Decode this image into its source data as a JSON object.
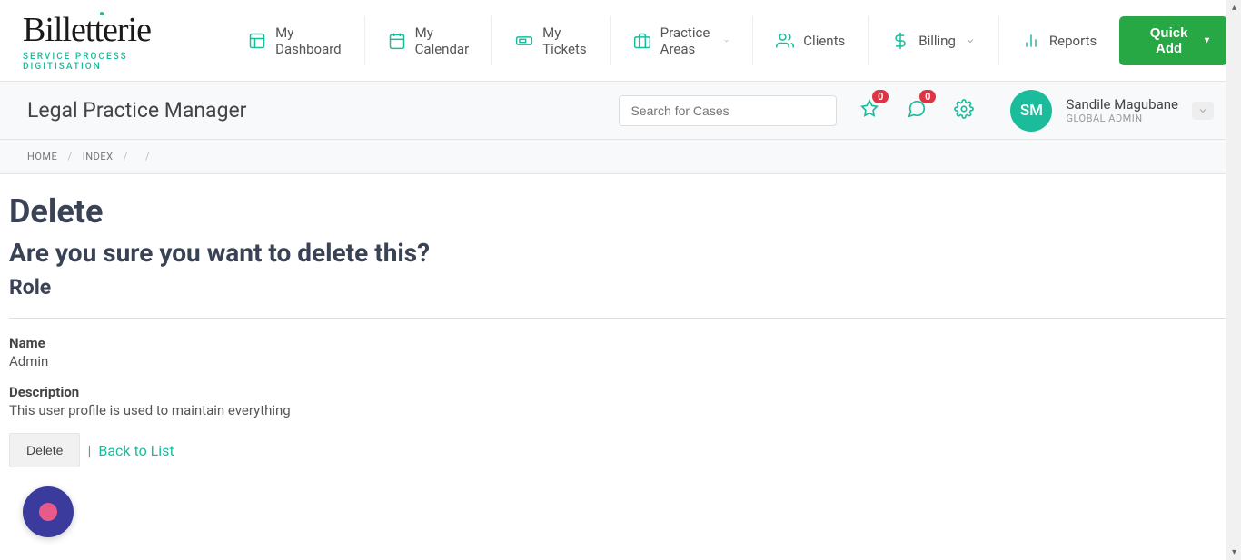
{
  "logo": {
    "main": "Billetterie",
    "tagline": "SERVICE PROCESS DIGITISATION"
  },
  "nav": {
    "dashboard": "My Dashboard",
    "calendar": "My Calendar",
    "tickets": "My Tickets",
    "practice": "Practice Areas",
    "clients": "Clients",
    "billing": "Billing",
    "reports": "Reports",
    "quick_add": "Quick Add"
  },
  "secondary": {
    "title": "Legal Practice Manager",
    "search_placeholder": "Search for Cases",
    "pin_badge": "0",
    "msg_badge": "0"
  },
  "user": {
    "initials": "SM",
    "name": "Sandile Magubane",
    "role": "GLOBAL ADMIN"
  },
  "breadcrumb": {
    "home": "HOME",
    "index": "INDEX"
  },
  "page": {
    "heading": "Delete",
    "confirm": "Are you sure you want to delete this?",
    "entity": "Role",
    "name_label": "Name",
    "name_value": "Admin",
    "desc_label": "Description",
    "desc_value": "This user profile is used to maintain everything",
    "delete_btn": "Delete",
    "back_link": "Back to List"
  }
}
